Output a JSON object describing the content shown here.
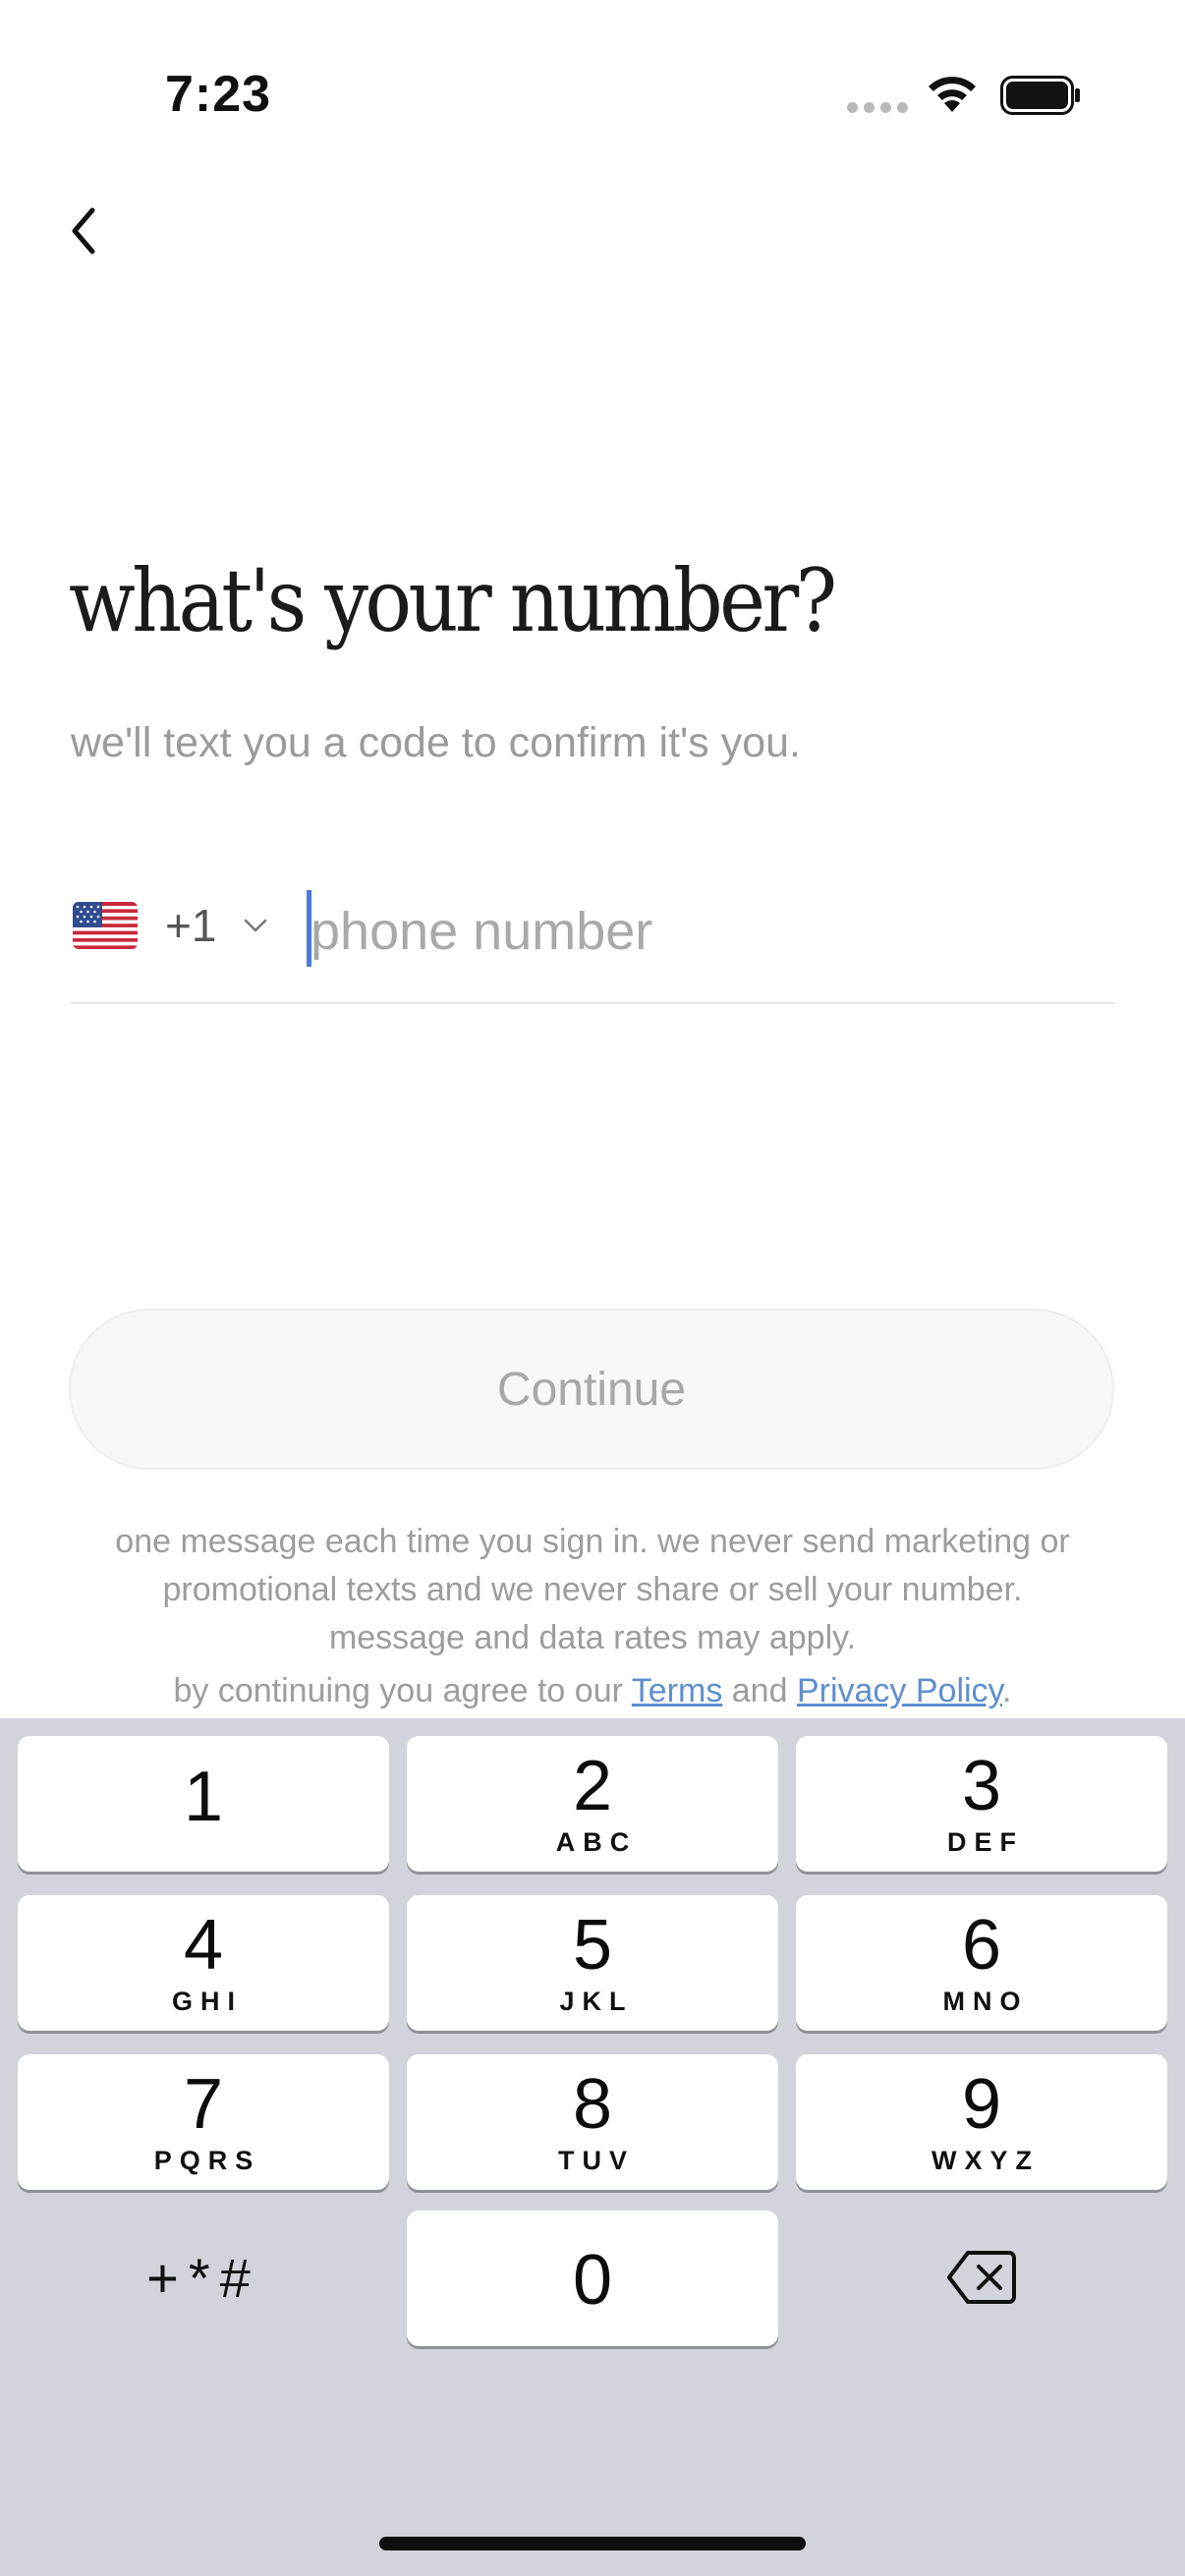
{
  "status_bar": {
    "time": "7:23"
  },
  "header": {
    "back_icon": "chevron-left-icon"
  },
  "main": {
    "title": "what's your number?",
    "subtitle": "we'll text you a code to confirm it's you."
  },
  "phone": {
    "country_flag": "us-flag-icon",
    "dial_code": "+1",
    "value": "",
    "placeholder": "phone number"
  },
  "continue_label": "Continue",
  "disclaimer": {
    "line1": "one message each time you sign in. we never send marketing or",
    "line2": "promotional texts and we never share or sell your number.",
    "line3": "message and data rates may apply.",
    "agree_prefix": "by continuing you agree to our ",
    "terms": "Terms",
    "and": " and ",
    "privacy": "Privacy Policy",
    "suffix": "."
  },
  "keypad": {
    "keys": [
      {
        "num": "1",
        "letters": ""
      },
      {
        "num": "2",
        "letters": "ABC"
      },
      {
        "num": "3",
        "letters": "DEF"
      },
      {
        "num": "4",
        "letters": "GHI"
      },
      {
        "num": "5",
        "letters": "JKL"
      },
      {
        "num": "6",
        "letters": "MNO"
      },
      {
        "num": "7",
        "letters": "PQRS"
      },
      {
        "num": "8",
        "letters": "TUV"
      },
      {
        "num": "9",
        "letters": "WXYZ"
      },
      {
        "num": "0",
        "letters": ""
      }
    ],
    "symbols": "+*#",
    "delete_icon": "backspace-icon"
  },
  "colors": {
    "link": "#5f8fd0",
    "cursor": "#4a7bd9",
    "keyboard_bg": "#d1d4da"
  }
}
